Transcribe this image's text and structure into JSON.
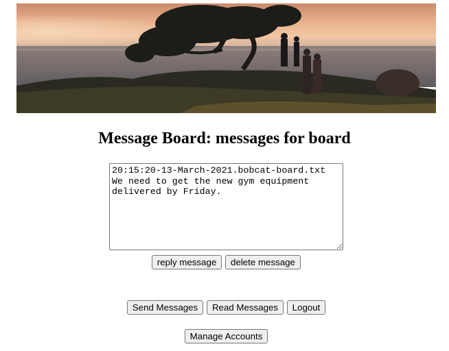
{
  "banner": {
    "alt": "Silhouetted people and a tree on a hill at sunset by the sea"
  },
  "page": {
    "title": "Message Board: messages for board"
  },
  "message": {
    "text": "20:15:20-13-March-2021.bobcat-board.txt\nWe need to get the new gym equipment\ndelivered by Friday."
  },
  "message_actions": {
    "reply_label": "reply message",
    "delete_label": "delete message"
  },
  "nav": {
    "send_label": "Send Messages",
    "read_label": "Read Messages",
    "logout_label": "Logout",
    "manage_label": "Manage Accounts"
  },
  "colors": {
    "button_bg": "#efefef",
    "button_border": "#767676"
  }
}
